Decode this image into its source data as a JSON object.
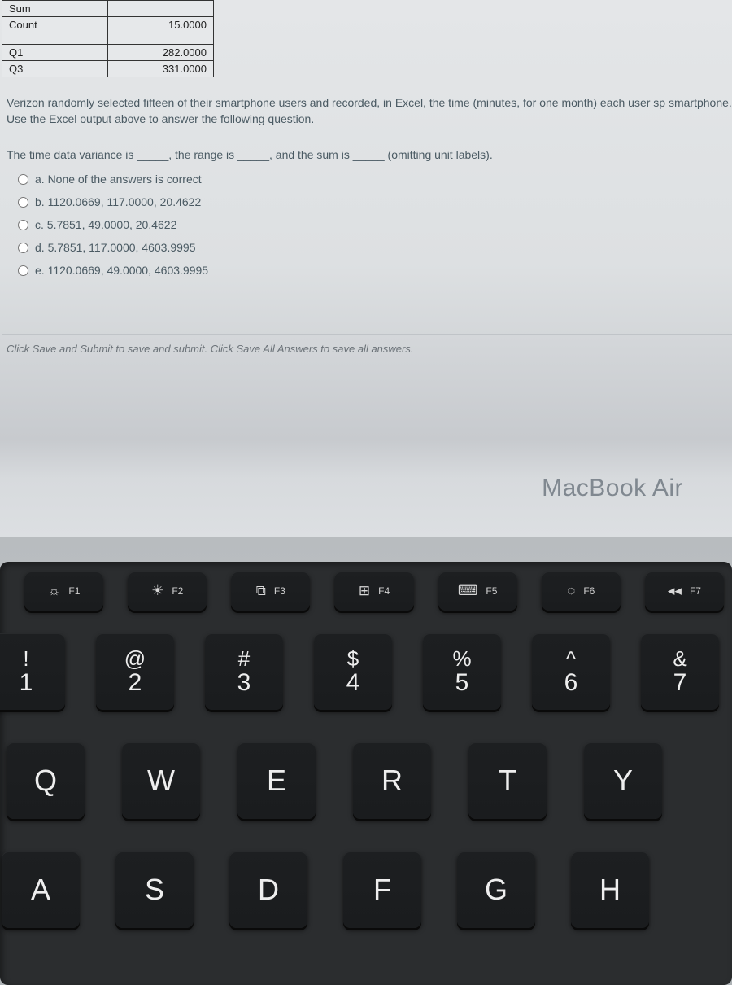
{
  "table": {
    "sum_label": "Sum",
    "sum_value": "",
    "count_label": "Count",
    "count_value": "15.0000",
    "q1_label": "Q1",
    "q1_value": "282.0000",
    "q3_label": "Q3",
    "q3_value": "331.0000"
  },
  "question": {
    "context": "Verizon randomly selected fifteen of their smartphone users and recorded, in Excel, the time (minutes, for one month) each user sp smartphone. Use the Excel output above to answer the following question.",
    "prompt_pre": "The time data variance is ",
    "blank": "_____",
    "prompt_mid1": ", the range is ",
    "prompt_mid2": ", and the sum is ",
    "prompt_post": " (omitting unit labels).",
    "options": [
      {
        "label": "a. None of the answers is correct"
      },
      {
        "label": "b. 1120.0669, 117.0000, 20.4622"
      },
      {
        "label": "c. 5.7851, 49.0000, 20.4622"
      },
      {
        "label": "d. 5.7851, 117.0000, 4603.9995"
      },
      {
        "label": "e. 1120.0669, 49.0000, 4603.9995"
      }
    ],
    "footer": "Click Save and Submit to save and submit. Click Save All Answers to save all answers."
  },
  "bezel": {
    "label": "MacBook Air"
  },
  "keyboard": {
    "fn": [
      {
        "icon": "☼",
        "label": "F1"
      },
      {
        "icon": "☀",
        "label": "F2"
      },
      {
        "icon": "⧉",
        "label": "F3"
      },
      {
        "icon": "⊞",
        "label": "F4"
      },
      {
        "icon": "⌨",
        "label": "F5"
      },
      {
        "icon": "◌",
        "label": "F6"
      },
      {
        "icon": "◂◂",
        "label": "F7"
      }
    ],
    "num": [
      {
        "sym": "!",
        "digit": "1"
      },
      {
        "sym": "@",
        "digit": "2"
      },
      {
        "sym": "#",
        "digit": "3"
      },
      {
        "sym": "$",
        "digit": "4"
      },
      {
        "sym": "%",
        "digit": "5"
      },
      {
        "sym": "^",
        "digit": "6"
      },
      {
        "sym": "&",
        "digit": "7"
      }
    ],
    "top": [
      "Q",
      "W",
      "E",
      "R",
      "T",
      "Y"
    ],
    "home": [
      "A",
      "S",
      "D",
      "F",
      "G",
      "H"
    ]
  }
}
